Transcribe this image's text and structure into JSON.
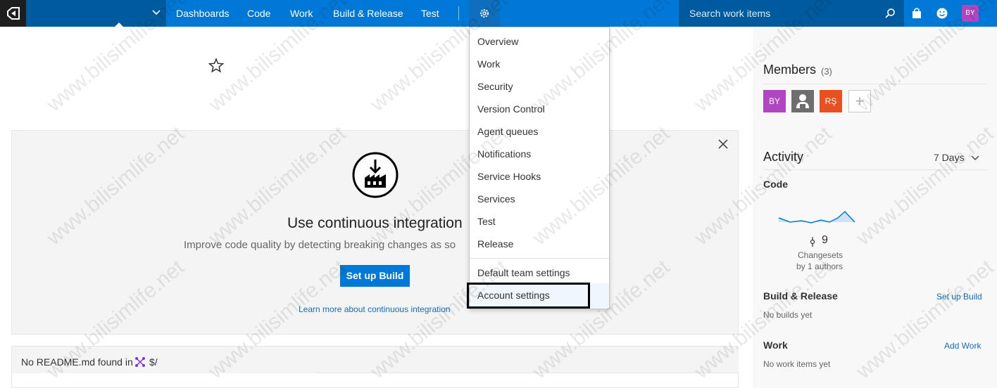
{
  "topbar": {
    "nav_items": [
      "Dashboards",
      "Code",
      "Work",
      "Build & Release",
      "Test"
    ],
    "search_placeholder": "Search work items",
    "user_initials": "BY",
    "accent": "#0078d7"
  },
  "settings_menu": {
    "items": [
      "Overview",
      "Work",
      "Security",
      "Version Control",
      "Agent queues",
      "Notifications",
      "Service Hooks",
      "Services",
      "Test",
      "Release"
    ],
    "team_item": "Default team settings",
    "account_item": "Account settings"
  },
  "ci_panel": {
    "title": "Use continuous integration",
    "description": "Improve code quality by detecting breaking changes as so",
    "button_label": "Set up Build",
    "learn_more": "Learn more about continuous integration"
  },
  "readme": {
    "message": "No README.md found in",
    "path": "$/"
  },
  "members": {
    "title": "Members",
    "count": "(3)",
    "avatars": [
      {
        "initials": "BY",
        "color": "#b146c2"
      },
      {
        "initials": "",
        "color": "#6e6e6e"
      },
      {
        "initials": "RŞ",
        "color": "#e8501f"
      }
    ],
    "add_symbol": "+"
  },
  "activity": {
    "title": "Activity",
    "period": "7 Days",
    "code_label": "Code",
    "commit_count": "9",
    "changesets_label": "Changesets",
    "authors_label": "by 1 authors",
    "build_title": "Build & Release",
    "build_link": "Set up Build",
    "build_empty": "No builds yet",
    "work_title": "Work",
    "work_link": "Add Work",
    "work_empty": "No work items yet"
  },
  "watermark": "www.bilisimlife.net"
}
